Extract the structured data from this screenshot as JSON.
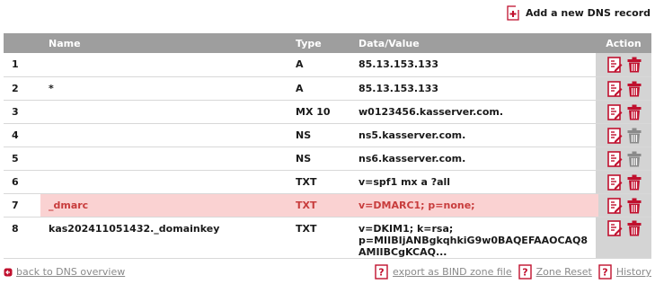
{
  "header": {
    "add_record_label": "Add a new DNS record"
  },
  "table": {
    "columns": {
      "number": "",
      "name": "Name",
      "type": "Type",
      "data": "Data/Value",
      "action": "Action"
    },
    "rows": [
      {
        "number": "1",
        "name": "",
        "type": "A",
        "data": "85.13.153.133",
        "delete_enabled": true,
        "highlighted": false
      },
      {
        "number": "2",
        "name": "*",
        "type": "A",
        "data": "85.13.153.133",
        "delete_enabled": true,
        "highlighted": false
      },
      {
        "number": "3",
        "name": "",
        "type": "MX 10",
        "data": "w0123456.kasserver.com.",
        "delete_enabled": true,
        "highlighted": false
      },
      {
        "number": "4",
        "name": "",
        "type": "NS",
        "data": "ns5.kasserver.com.",
        "delete_enabled": false,
        "highlighted": false
      },
      {
        "number": "5",
        "name": "",
        "type": "NS",
        "data": "ns6.kasserver.com.",
        "delete_enabled": false,
        "highlighted": false
      },
      {
        "number": "6",
        "name": "",
        "type": "TXT",
        "data": "v=spf1 mx a ?all",
        "delete_enabled": true,
        "highlighted": false
      },
      {
        "number": "7",
        "name": "_dmarc",
        "type": "TXT",
        "data": "v=DMARC1; p=none;",
        "delete_enabled": true,
        "highlighted": true
      },
      {
        "number": "8",
        "name": "kas202411051432._domainkey",
        "type": "TXT",
        "data_lines": [
          "v=DKIM1; k=rsa;",
          "p=MIIBIjANBgkqhkiG9w0BAQEFAAOCAQ8",
          "AMIIBCgKCAQ..."
        ],
        "delete_enabled": true,
        "highlighted": false
      }
    ]
  },
  "footer": {
    "back_label": "back to DNS overview",
    "export_label": "export as BIND zone file",
    "reset_label": "Zone Reset",
    "history_label": "History"
  },
  "colors": {
    "header_bg": "#9e9e9e",
    "action_col_bg": "#d4d4d4",
    "highlight_bg": "#fad2d2",
    "highlight_text": "#c83c3c",
    "icon_red": "#c0102e",
    "icon_gray": "#8a8a8a"
  },
  "icons": {
    "add": "add-record-icon",
    "edit": "edit-record-icon",
    "delete": "trash-icon",
    "bullet": "bullet-icon",
    "export": "question-doc-icon"
  }
}
